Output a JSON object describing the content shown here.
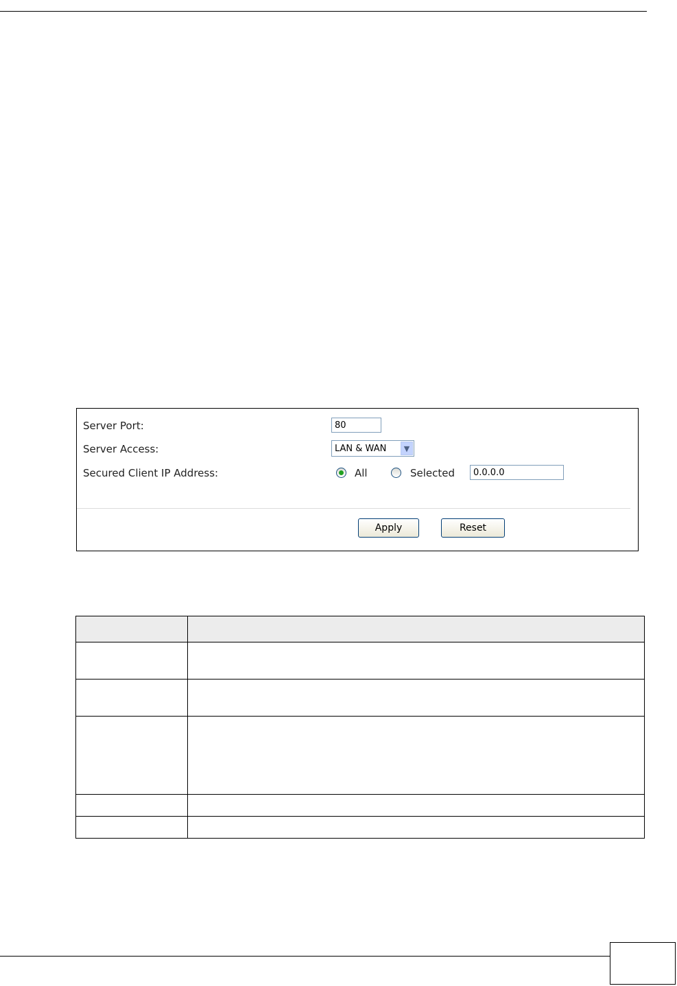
{
  "panel": {
    "server_port_label": "Server Port:",
    "server_port_value": "80",
    "server_access_label": "Server Access:",
    "server_access_selected": "LAN & WAN",
    "secured_client_label": "Secured Client IP Address:",
    "radio_all_label": "All",
    "radio_selected_label": "Selected",
    "radio_checked": "All",
    "ip_value": "0.0.0.0",
    "apply_label": "Apply",
    "reset_label": "Reset"
  },
  "colors": {
    "input_border": "#7f9db9",
    "radio_dot": "#21a121",
    "table_header_bg": "#ececec"
  },
  "icons": [
    "chevron-down-icon"
  ]
}
